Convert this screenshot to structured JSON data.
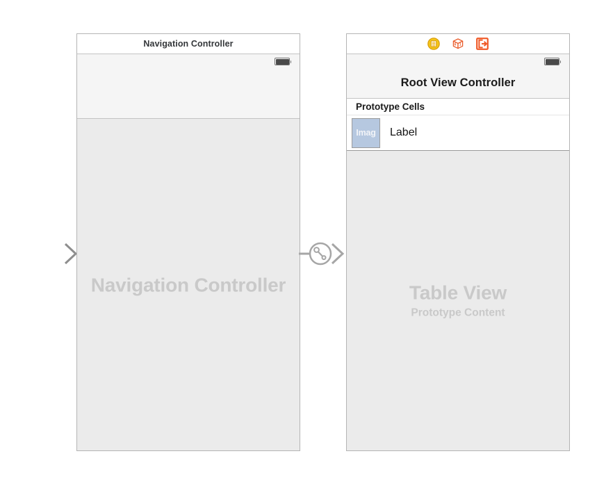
{
  "canvas": {
    "background_color": "#ffffff",
    "placeholder_text_color": "#c9c9c9",
    "panel_border_color": "#b4b4b4",
    "arrow_color": "#a6a6a6"
  },
  "scenes": [
    {
      "id": "navigation-controller-scene",
      "titlebar": "Navigation Controller",
      "placeholder_title": "Navigation Controller",
      "placeholder_subtitle": "",
      "battery": "battery-full-icon"
    },
    {
      "id": "root-view-controller-scene",
      "dock_icons": [
        {
          "name": "view-controller-icon",
          "label": "View Controller",
          "color": "#f5b517"
        },
        {
          "name": "first-responder-icon",
          "label": "First Responder",
          "color": "#eb5a2a"
        },
        {
          "name": "exit-icon",
          "label": "Exit",
          "color": "#f05a28"
        }
      ],
      "nav_title": "Root View Controller",
      "battery": "battery-full-icon",
      "table": {
        "section_header": "Prototype Cells",
        "cells": [
          {
            "image_placeholder": "Imag",
            "label": "Label"
          }
        ]
      },
      "placeholder_title": "Table View",
      "placeholder_subtitle": "Prototype Content"
    }
  ],
  "connections": [
    {
      "name": "initial-view-controller-entry-arrow",
      "kind": "entry-point-arrow"
    },
    {
      "name": "show-segue-connection",
      "kind": "segue",
      "icon": "segue-show-icon"
    }
  ]
}
